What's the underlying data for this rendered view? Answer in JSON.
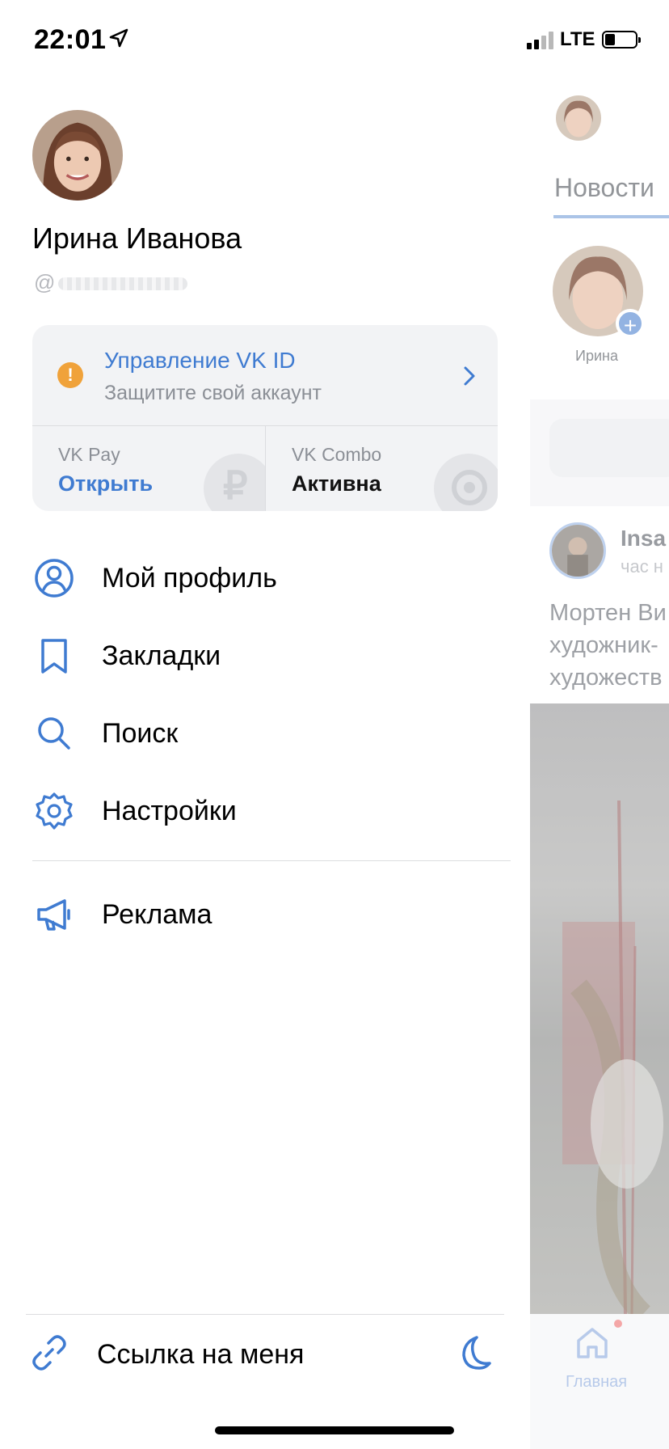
{
  "status_bar": {
    "time": "22:01",
    "network": "LTE"
  },
  "profile": {
    "name": "Ирина Иванова",
    "handle_prefix": "@"
  },
  "vk_id_card": {
    "title": "Управление VK ID",
    "subtitle": "Защитите свой аккаунт",
    "pay": {
      "label": "VK Pay",
      "value": "Открыть"
    },
    "combo": {
      "label": "VK Combo",
      "value": "Активна"
    }
  },
  "menu": {
    "items": [
      {
        "label": "Мой профиль",
        "icon": "profile-icon"
      },
      {
        "label": "Закладки",
        "icon": "bookmark-icon"
      },
      {
        "label": "Поиск",
        "icon": "search-icon"
      },
      {
        "label": "Настройки",
        "icon": "settings-icon"
      },
      {
        "label": "Реклама",
        "icon": "megaphone-icon"
      }
    ]
  },
  "bottom": {
    "link_label": "Ссылка на меня"
  },
  "feed": {
    "tab": "Новости",
    "story_name": "Ирина",
    "post_author": "Insa",
    "post_time": "час н",
    "post_text_lines": [
      "Мортен Ви",
      "художник-",
      "художеств"
    ],
    "tabbar_home": "Главная"
  },
  "colors": {
    "accent": "#3f7bd1",
    "warning": "#f0a23a",
    "card_bg": "#f2f3f5"
  }
}
